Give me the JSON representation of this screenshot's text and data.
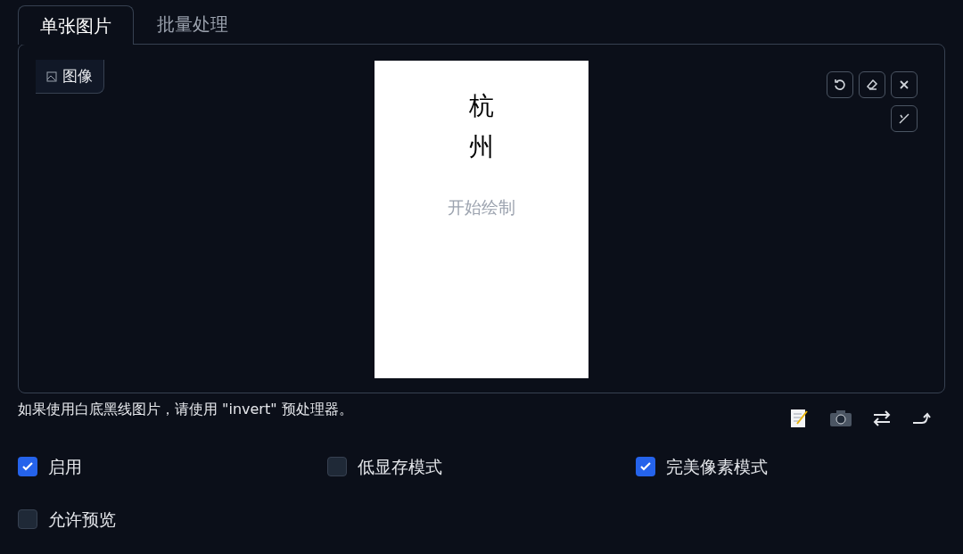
{
  "tabs": [
    {
      "label": "单张图片",
      "selected": true
    },
    {
      "label": "批量处理",
      "selected": false
    }
  ],
  "image_panel": {
    "label": "图像",
    "canvas_lines": [
      "杭",
      "州"
    ],
    "placeholder": "开始绘制"
  },
  "hint": "如果使用白底黑线图片，请使用 \"invert\" 预处理器。",
  "options": [
    {
      "label": "启用",
      "checked": true
    },
    {
      "label": "低显存模式",
      "checked": false
    },
    {
      "label": "完美像素模式",
      "checked": true
    },
    {
      "label": "允许预览",
      "checked": false
    }
  ]
}
